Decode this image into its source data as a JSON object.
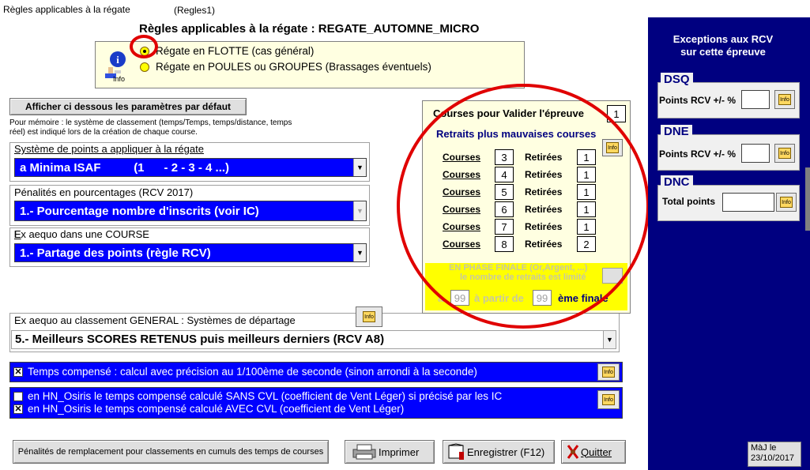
{
  "window": {
    "title": "Règles applicables à la régate"
  },
  "header": {
    "title": "Règles applicables à la régate : REGATE_AUTOMNE_MICRO",
    "suffix": "(Regles1)"
  },
  "mode": {
    "info_label": "Info",
    "option1": "Régate en FLOTTE (cas général)",
    "option2": "Régate en POULES ou GROUPES (Brassages éventuels)",
    "selected": "option1"
  },
  "defaults_button": "Afficher ci dessous les paramètres par défaut",
  "memo": "Pour mémoire : le système de classement (temps/Temps, temps/distance, temps réel) est indiqué lors de la création de chaque course.",
  "points_system": {
    "label": "Système de points a appliquer à la régate",
    "value": "a Minima ISAF          (1      - 2 - 3 - 4 ...)"
  },
  "penalties": {
    "label": "Pénalités en pourcentages (RCV 2017)",
    "value": "1.- Pourcentage nombre d'inscrits (voir IC)"
  },
  "tie_race": {
    "label": "Ex aequo dans une COURSE",
    "value": "1.- Partage des points (règle RCV)"
  },
  "tie_general": {
    "label": "Ex aequo au classement GENERAL : Systèmes de départage",
    "value": "5.- Meilleurs SCORES  RETENUS puis meilleurs derniers (RCV A8)"
  },
  "compensated": {
    "text": "Temps compensé :  calcul avec précision au 1/100ème de seconde (sinon arrondi à la seconde)",
    "checked": true
  },
  "osiris": {
    "sans": {
      "text": "en HN_Osiris le temps compensé calculé SANS CVL (coefficient de Vent Léger) si précisé par les IC",
      "checked": false
    },
    "avec": {
      "text": "en HN_Osiris le temps compensé calculé AVEC CVL (coefficient de Vent Léger)",
      "checked": true
    }
  },
  "discards": {
    "validate_label": "Courses pour Valider l'épreuve",
    "validate_value": "1",
    "title": "Retraits plus mauvaises courses",
    "courses_label": "Courses",
    "retirees_label": "Retirées",
    "rows": [
      {
        "courses": "3",
        "retirees": "1"
      },
      {
        "courses": "4",
        "retirees": "1"
      },
      {
        "courses": "5",
        "retirees": "1"
      },
      {
        "courses": "6",
        "retirees": "1"
      },
      {
        "courses": "7",
        "retirees": "1"
      },
      {
        "courses": "8",
        "retirees": "2"
      }
    ],
    "final_line1": "EN PHASE FINALE (Or,Argent, ...)",
    "final_line2": "le nombre de retraits est limité",
    "final_a": "à",
    "final_a_value": "99",
    "final_from": "à partir de",
    "final_from_value": "99",
    "final_suffix": "ème finale"
  },
  "info_button_label": "Info",
  "exceptions": {
    "title_line1": "Exceptions aux RCV",
    "title_line2": "sur cette épreuve",
    "dsq": {
      "head": "DSQ",
      "label": "Points RCV +/- %",
      "value": ""
    },
    "dne": {
      "head": "DNE",
      "label": "Points RCV +/- %",
      "value": ""
    },
    "dnc": {
      "head": "DNC",
      "label": "Total points",
      "value": ""
    }
  },
  "bottom": {
    "penalties_button": "Pénalités de remplacement pour classements  en cumuls des temps de courses",
    "print": "Imprimer",
    "save": "Enregistrer (F12)",
    "quit": "Quitter"
  },
  "updated": {
    "label": "MàJ le",
    "date": "23/10/2017"
  },
  "colors": {
    "accent": "#0000ff",
    "panel": "#000080",
    "highlight": "#ffff00",
    "annotation": "#e00000"
  }
}
